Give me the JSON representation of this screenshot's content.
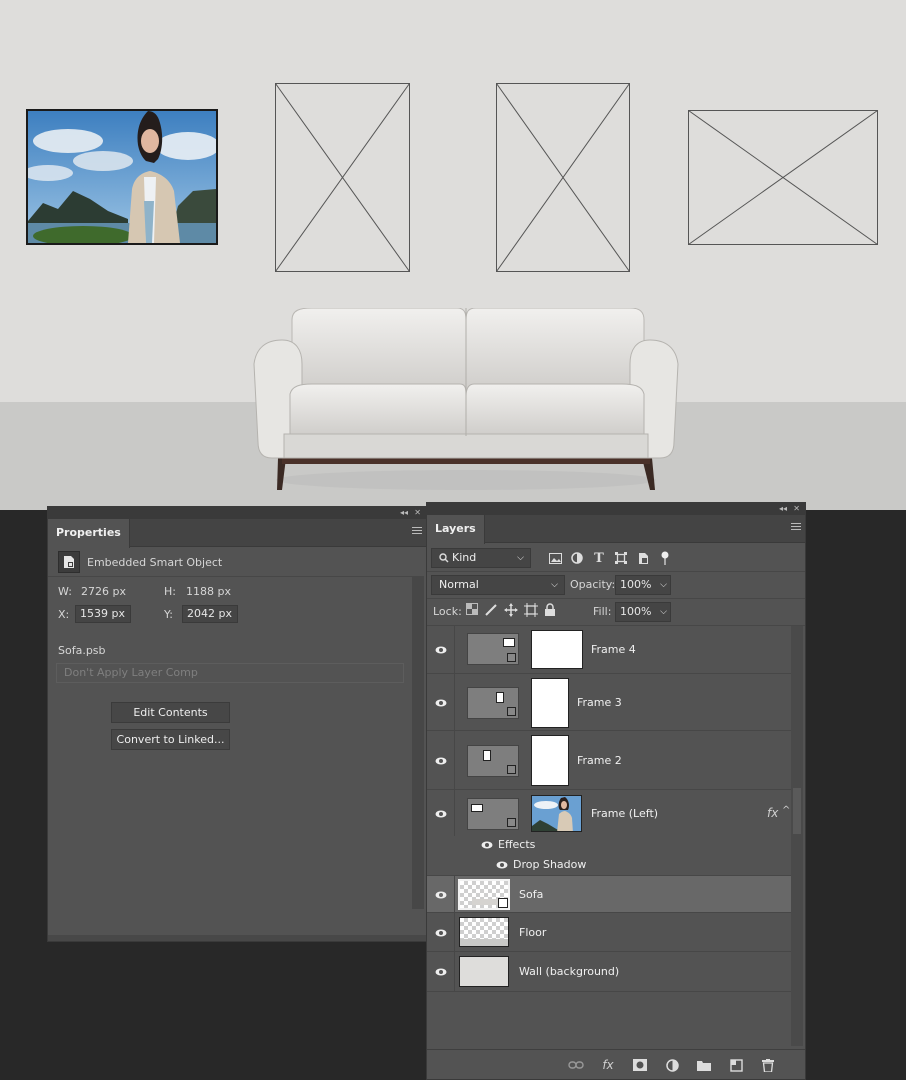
{
  "document": {
    "wall_color": "#dedddb",
    "floor_color": "#c9c9c7"
  },
  "properties": {
    "tab_label": "Properties",
    "object_type": "Embedded Smart Object",
    "w_label": "W:",
    "w_value": "2726 px",
    "h_label": "H:",
    "h_value": "1188 px",
    "x_label": "X:",
    "x_value": "1539 px",
    "y_label": "Y:",
    "y_value": "2042 px",
    "filename": "Sofa.psb",
    "layer_comp_placeholder": "Don't Apply Layer Comp",
    "edit_contents_label": "Edit Contents",
    "convert_label": "Convert to Linked..."
  },
  "layers": {
    "tab_label": "Layers",
    "filter_kind": "Kind",
    "blend_mode": "Normal",
    "opacity_label": "Opacity:",
    "opacity_value": "100%",
    "lock_label": "Lock:",
    "fill_label": "Fill:",
    "fill_value": "100%",
    "items": [
      {
        "name": "Frame 4"
      },
      {
        "name": "Frame 3"
      },
      {
        "name": "Frame 2"
      },
      {
        "name": "Frame (Left)",
        "fx": "fx"
      },
      {
        "name": "Sofa"
      },
      {
        "name": "Floor"
      },
      {
        "name": "Wall (background)"
      }
    ],
    "effects_label": "Effects",
    "drop_shadow_label": "Drop Shadow"
  },
  "icons": {
    "footer": [
      "link-icon",
      "fx-icon",
      "mask-icon",
      "adjustment-icon",
      "folder-icon",
      "new-layer-icon",
      "trash-icon"
    ]
  }
}
